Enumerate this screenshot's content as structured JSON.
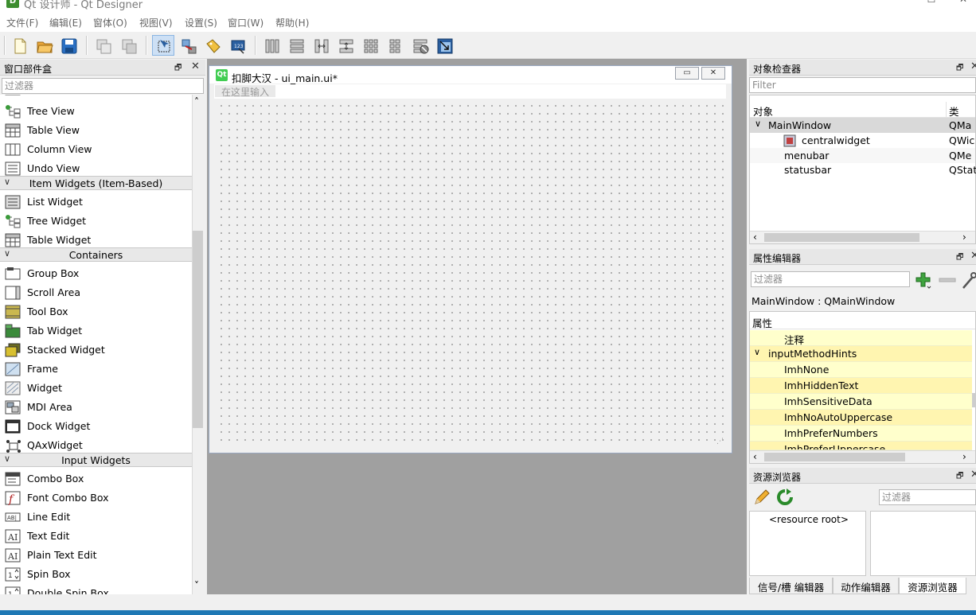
{
  "window": {
    "title": "Qt 设计师 - Qt Designer",
    "minimize": "—",
    "maximize": "☐",
    "close": "✕"
  },
  "menu": [
    "文件(F)",
    "编辑(E)",
    "窗体(O)",
    "视图(V)",
    "设置(S)",
    "窗口(W)",
    "帮助(H)"
  ],
  "widget_box": {
    "title": "窗口部件盒",
    "float": "🗗",
    "close": "✕",
    "filter_placeholder": "过滤器",
    "items": [
      {
        "kind": "item",
        "label": "Tree View",
        "icon": "tree-view-icon"
      },
      {
        "kind": "item",
        "label": "Table View",
        "icon": "table-view-icon"
      },
      {
        "kind": "item",
        "label": "Column View",
        "icon": "column-view-icon"
      },
      {
        "kind": "item",
        "label": "Undo View",
        "icon": "undo-view-icon"
      },
      {
        "kind": "category",
        "label": "Item Widgets (Item-Based)"
      },
      {
        "kind": "item",
        "label": "List Widget",
        "icon": "list-widget-icon"
      },
      {
        "kind": "item",
        "label": "Tree Widget",
        "icon": "tree-widget-icon"
      },
      {
        "kind": "item",
        "label": "Table Widget",
        "icon": "table-widget-icon"
      },
      {
        "kind": "category",
        "label": "Containers"
      },
      {
        "kind": "item",
        "label": "Group Box",
        "icon": "group-box-icon"
      },
      {
        "kind": "item",
        "label": "Scroll Area",
        "icon": "scroll-area-icon"
      },
      {
        "kind": "item",
        "label": "Tool Box",
        "icon": "tool-box-icon"
      },
      {
        "kind": "item",
        "label": "Tab Widget",
        "icon": "tab-widget-icon"
      },
      {
        "kind": "item",
        "label": "Stacked Widget",
        "icon": "stacked-widget-icon"
      },
      {
        "kind": "item",
        "label": "Frame",
        "icon": "frame-icon"
      },
      {
        "kind": "item",
        "label": "Widget",
        "icon": "widget-icon"
      },
      {
        "kind": "item",
        "label": "MDI Area",
        "icon": "mdi-area-icon"
      },
      {
        "kind": "item",
        "label": "Dock Widget",
        "icon": "dock-widget-icon"
      },
      {
        "kind": "item",
        "label": "QAxWidget",
        "icon": "qaxwidget-icon"
      },
      {
        "kind": "category",
        "label": "Input Widgets"
      },
      {
        "kind": "item",
        "label": "Combo Box",
        "icon": "combo-box-icon"
      },
      {
        "kind": "item",
        "label": "Font Combo Box",
        "icon": "font-combo-box-icon"
      },
      {
        "kind": "item",
        "label": "Line Edit",
        "icon": "line-edit-icon"
      },
      {
        "kind": "item",
        "label": "Text Edit",
        "icon": "text-edit-icon"
      },
      {
        "kind": "item",
        "label": "Plain Text Edit",
        "icon": "plain-text-edit-icon"
      },
      {
        "kind": "item",
        "label": "Spin Box",
        "icon": "spin-box-icon"
      },
      {
        "kind": "item",
        "label": "Double Spin Box",
        "icon": "double-spin-box-icon"
      }
    ]
  },
  "form": {
    "title": "扣脚大汉 - ui_main.ui*",
    "qt_badge": "Qt",
    "minimize": "▭",
    "close": "✕",
    "menu_placeholder": "在这里输入"
  },
  "object_inspector": {
    "title": "对象检查器",
    "float": "🗗",
    "close": "✕",
    "filter_placeholder": "Filter",
    "col_object": "对象",
    "col_class": "类",
    "rows": [
      {
        "name": "MainWindow",
        "cls": "QMa",
        "expand": "∨"
      },
      {
        "name": "centralwidget",
        "cls": "QWic"
      },
      {
        "name": "menubar",
        "cls": "QMe"
      },
      {
        "name": "statusbar",
        "cls": "QStat"
      }
    ],
    "scroll_left": "‹",
    "scroll_right": "›"
  },
  "property_editor": {
    "title": "属性编辑器",
    "float": "🗗",
    "close": "✕",
    "filter_placeholder": "过滤器",
    "context": "MainWindow : QMainWindow",
    "header": "属性",
    "expand": "∨",
    "rows": [
      "注释",
      "inputMethodHints",
      "ImhNone",
      "ImhHiddenText",
      "ImhSensitiveData",
      "ImhNoAutoUppercase",
      "ImhPreferNumbers",
      "ImhPreferUppercase"
    ],
    "scroll_left": "‹",
    "scroll_right": "›"
  },
  "resource_browser": {
    "title": "资源浏览器",
    "float": "🗗",
    "close": "✕",
    "filter_placeholder": "过滤器",
    "root": "<resource root>"
  },
  "bottom_tabs": [
    "信号/槽 编辑器",
    "动作编辑器",
    "资源浏览器"
  ],
  "scroll": {
    "up": "˄",
    "down": "˅"
  },
  "category_chevron": "∨",
  "colors": {
    "selection": "#cde0f5",
    "property_row": "#ffffcc",
    "taskbar": "#1e78b4"
  }
}
